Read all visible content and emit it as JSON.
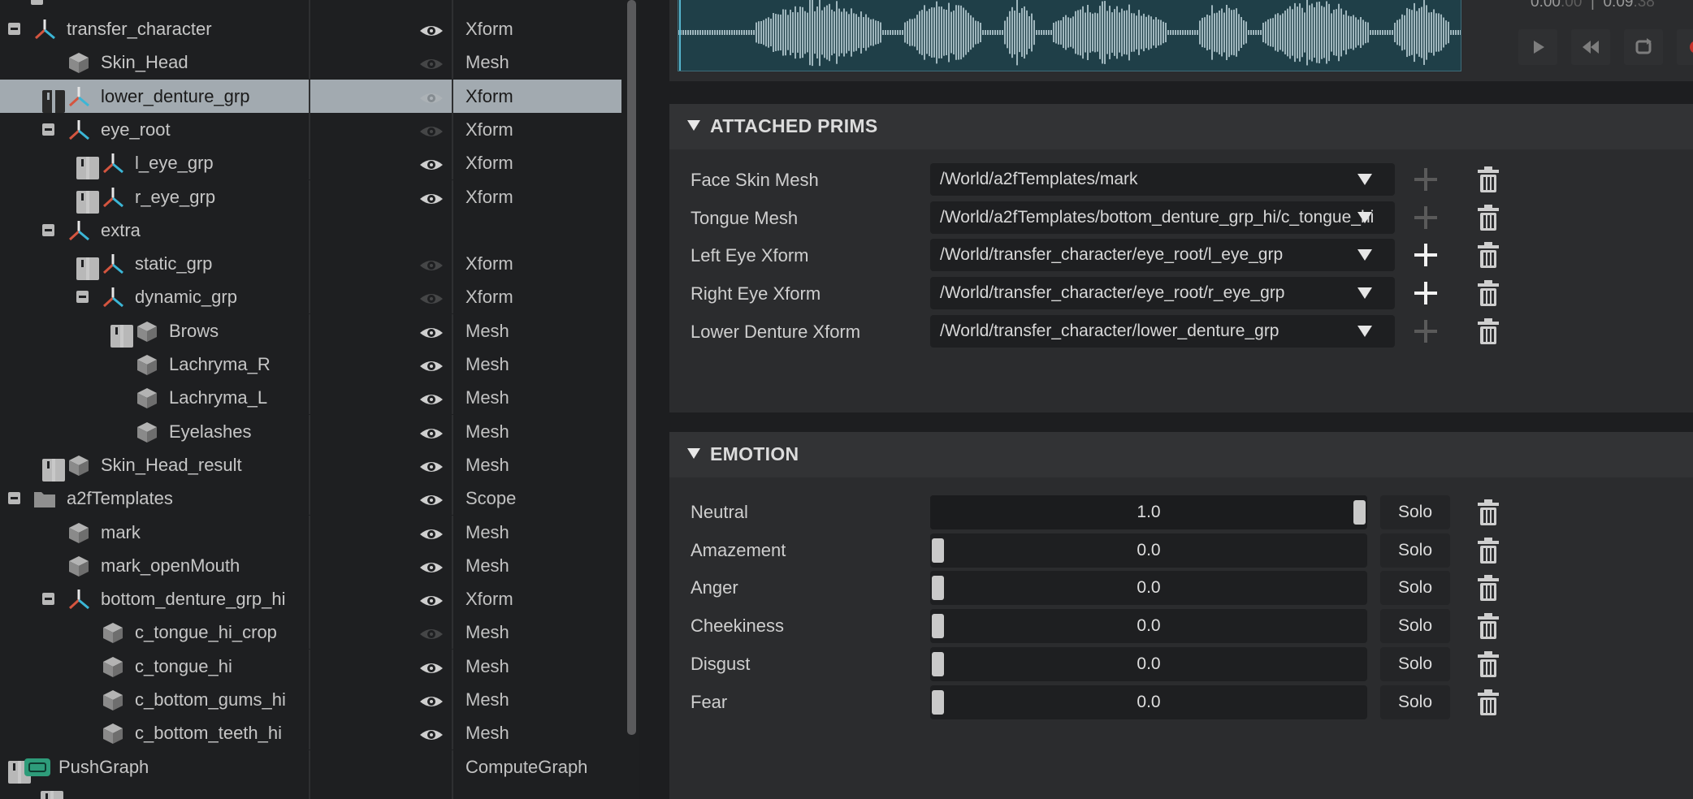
{
  "stage": {
    "rows": [
      {
        "name": "transfer_character",
        "type": "Xform",
        "toggle": "minus",
        "icon": "xform",
        "visible": true
      },
      {
        "name": "Skin_Head",
        "type": "Mesh",
        "toggle": "none",
        "icon": "mesh",
        "visible": false
      },
      {
        "name": "lower_denture_grp",
        "type": "Xform",
        "toggle": "plus",
        "icon": "xform",
        "visible": false,
        "selected": true
      },
      {
        "name": "eye_root",
        "type": "Xform",
        "toggle": "minus",
        "icon": "xform",
        "visible": false
      },
      {
        "name": "l_eye_grp",
        "type": "Xform",
        "toggle": "plus",
        "icon": "xform",
        "visible": true
      },
      {
        "name": "r_eye_grp",
        "type": "Xform",
        "toggle": "plus",
        "icon": "xform",
        "visible": true
      },
      {
        "name": "extra",
        "type": "",
        "toggle": "minus",
        "icon": "xform",
        "visible": null
      },
      {
        "name": "static_grp",
        "type": "Xform",
        "toggle": "plus",
        "icon": "xform",
        "visible": false
      },
      {
        "name": "dynamic_grp",
        "type": "Xform",
        "toggle": "minus",
        "icon": "xform",
        "visible": false
      },
      {
        "name": "Brows",
        "type": "Mesh",
        "toggle": "plus",
        "icon": "mesh",
        "visible": true
      },
      {
        "name": "Lachryma_R",
        "type": "Mesh",
        "toggle": "none",
        "icon": "mesh",
        "visible": true
      },
      {
        "name": "Lachryma_L",
        "type": "Mesh",
        "toggle": "none",
        "icon": "mesh",
        "visible": true
      },
      {
        "name": "Eyelashes",
        "type": "Mesh",
        "toggle": "none",
        "icon": "mesh",
        "visible": true
      },
      {
        "name": "Skin_Head_result",
        "type": "Mesh",
        "toggle": "plus",
        "icon": "mesh",
        "visible": true
      },
      {
        "name": "a2fTemplates",
        "type": "Scope",
        "toggle": "minus",
        "icon": "folder",
        "visible": true
      },
      {
        "name": "mark",
        "type": "Mesh",
        "toggle": "none",
        "icon": "mesh",
        "visible": true
      },
      {
        "name": "mark_openMouth",
        "type": "Mesh",
        "toggle": "none",
        "icon": "mesh",
        "visible": true
      },
      {
        "name": "bottom_denture_grp_hi",
        "type": "Xform",
        "toggle": "minus",
        "icon": "xform",
        "visible": true
      },
      {
        "name": "c_tongue_hi_crop",
        "type": "Mesh",
        "toggle": "none",
        "icon": "mesh",
        "visible": false
      },
      {
        "name": "c_tongue_hi",
        "type": "Mesh",
        "toggle": "none",
        "icon": "mesh",
        "visible": true
      },
      {
        "name": "c_bottom_gums_hi",
        "type": "Mesh",
        "toggle": "none",
        "icon": "mesh",
        "visible": true
      },
      {
        "name": "c_bottom_teeth_hi",
        "type": "Mesh",
        "toggle": "none",
        "icon": "mesh",
        "visible": true
      },
      {
        "name": "PushGraph",
        "type": "ComputeGraph",
        "toggle": "plus",
        "icon": "graph",
        "visible": null
      }
    ]
  },
  "audio": {
    "current_time_main": "0:00",
    "current_time_frac": ".00",
    "separator": "|",
    "total_time_main": "0:09",
    "total_time_frac": ".38",
    "buttons": [
      "play-icon",
      "rewind-icon",
      "loop-icon",
      "record-icon"
    ]
  },
  "attached_prims": {
    "title": "ATTACHED PRIMS",
    "rows": [
      {
        "label": "Face Skin Mesh",
        "value": "/World/a2fTemplates/mark",
        "add_enabled": false
      },
      {
        "label": "Tongue Mesh",
        "value": "/World/a2fTemplates/bottom_denture_grp_hi/c_tongue_hi",
        "add_enabled": false
      },
      {
        "label": "Left Eye Xform",
        "value": "/World/transfer_character/eye_root/l_eye_grp",
        "add_enabled": true
      },
      {
        "label": "Right Eye Xform",
        "value": "/World/transfer_character/eye_root/r_eye_grp",
        "add_enabled": true
      },
      {
        "label": "Lower Denture Xform",
        "value": "/World/transfer_character/lower_denture_grp",
        "add_enabled": false
      }
    ]
  },
  "emotion": {
    "title": "EMOTION",
    "solo_label": "Solo",
    "rows": [
      {
        "label": "Neutral",
        "value": "1.0",
        "level": 1.0
      },
      {
        "label": "Amazement",
        "value": "0.0",
        "level": 0.0
      },
      {
        "label": "Anger",
        "value": "0.0",
        "level": 0.0
      },
      {
        "label": "Cheekiness",
        "value": "0.0",
        "level": 0.0
      },
      {
        "label": "Disgust",
        "value": "0.0",
        "level": 0.0
      },
      {
        "label": "Fear",
        "value": "0.0",
        "level": 0.0
      }
    ]
  },
  "colors": {
    "xform_icon_red": "#d4553f",
    "xform_icon_cyan": "#3bb6d6",
    "xform_icon_white": "#e6e6e6",
    "selected_row": "#a2aab0",
    "waveform_bg": "#1f3f48",
    "waveform": "#9fb6bd",
    "record": "#c8322b"
  }
}
